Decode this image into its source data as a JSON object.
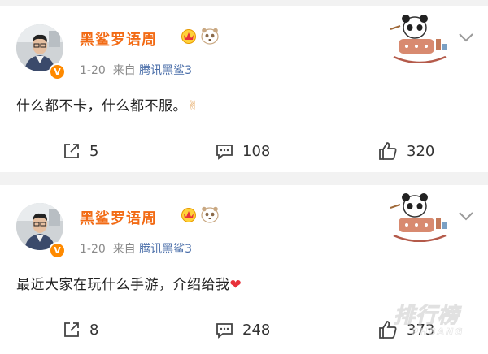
{
  "posts": [
    {
      "author": "黑鲨罗语周",
      "date": "1-20",
      "source_prefix": "来自",
      "source": "腾讯黑鲨3",
      "text": "什么都不卡，什么都不服。",
      "text_emoji": "✌",
      "shares": "5",
      "comments": "108",
      "likes": "320"
    },
    {
      "author": "黑鲨罗语周",
      "date": "1-20",
      "source_prefix": "来自",
      "source": "腾讯黑鲨3",
      "text": "最近大家在玩什么手游，介绍给我",
      "text_emoji": "❤",
      "shares": "8",
      "comments": "248",
      "likes": "373"
    }
  ],
  "watermark": {
    "main": "排行榜",
    "sub": "PHBANG"
  },
  "colors": {
    "author": "#f26b15",
    "source": "#4a6ea9",
    "badge": "#ff8a00",
    "heart": "#e8313a"
  }
}
